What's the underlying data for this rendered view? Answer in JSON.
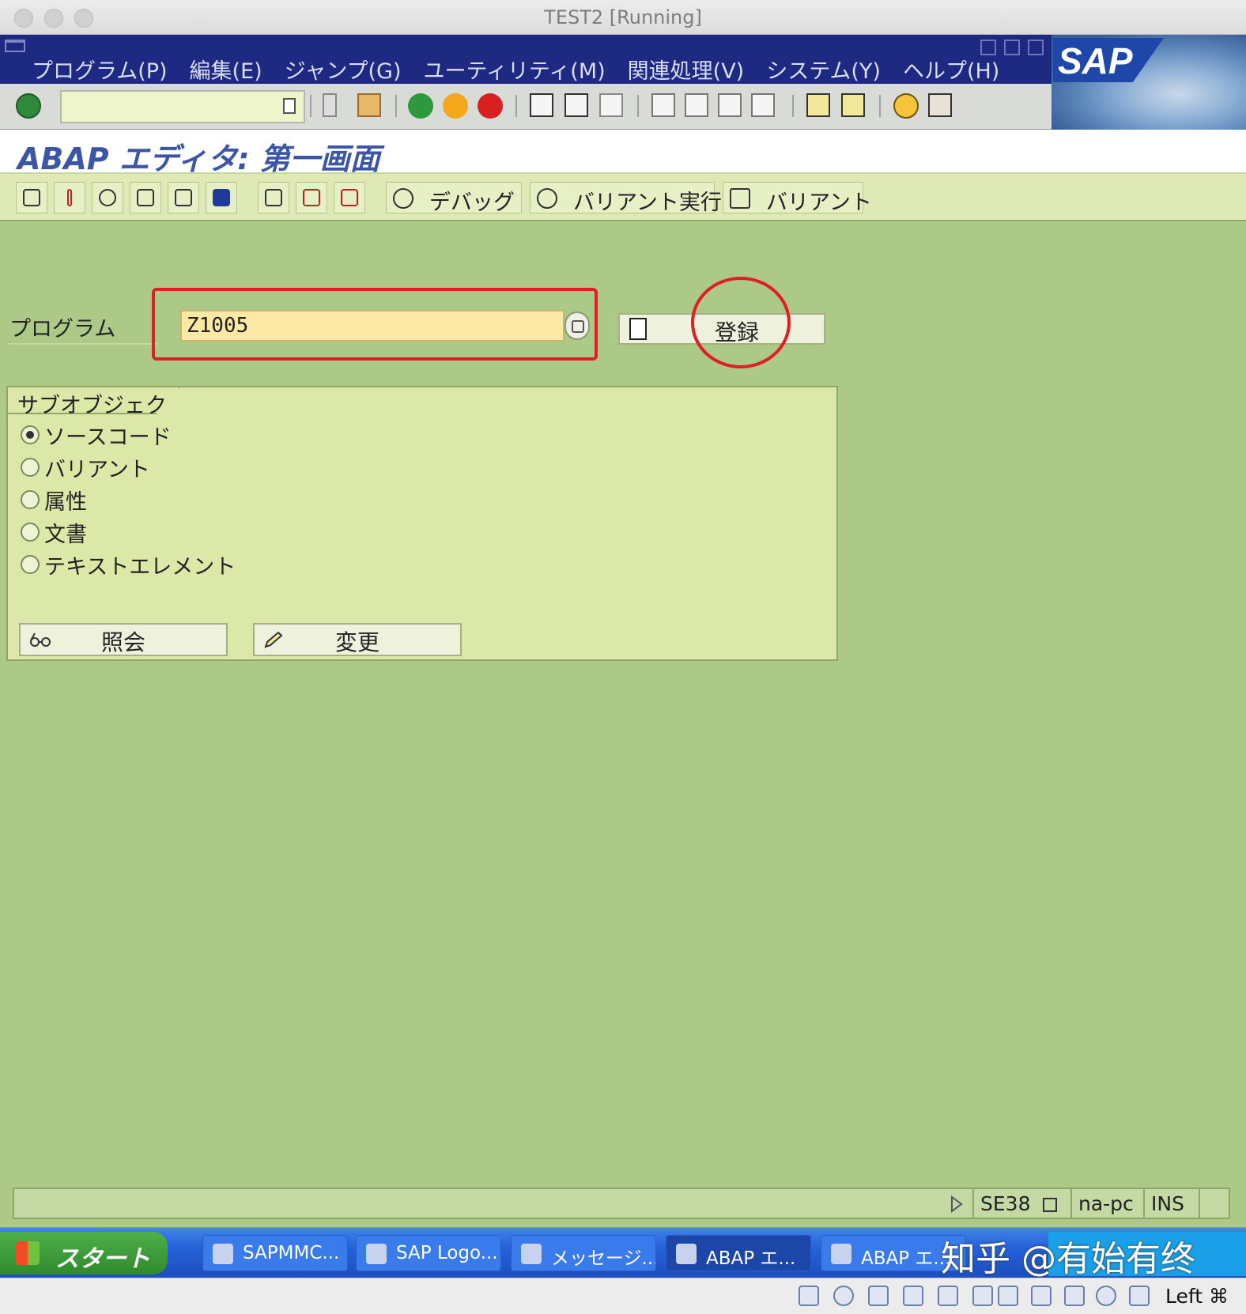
{
  "window": {
    "title": "TEST2 [Running]"
  },
  "menu": [
    "プログラム(P)",
    "編集(E)",
    "ジャンプ(G)",
    "ユーティリティ(M)",
    "関連処理(V)",
    "システム(Y)",
    "ヘルプ(H)"
  ],
  "brand": {
    "logo_text": "SAP"
  },
  "command_field": {
    "value": ""
  },
  "page": {
    "title": "ABAP エディタ: 第一画面"
  },
  "app_toolbar": {
    "debug_label": "デバッグ",
    "variant_run_label": "バリアント実行",
    "variant_label": "バリアント"
  },
  "form": {
    "program_label": "プログラム",
    "program_value": "Z1005",
    "create_label": "登録"
  },
  "subobjects": {
    "title": "サブオブジェクト",
    "options": [
      "ソースコード",
      "バリアント",
      "属性",
      "文書",
      "テキストエレメント"
    ],
    "selected_index": 0,
    "display_label": "照会",
    "change_label": "変更"
  },
  "status": {
    "transaction": "SE38",
    "server": "na-pc",
    "mode": "INS"
  },
  "taskbar": {
    "start_label": "スタート",
    "tasks": [
      "SAPMMC...",
      "SAP Logo...",
      "メッセージ...",
      "ABAP エ...",
      "ABAP エ..."
    ],
    "watermark": "知乎 @有始有终"
  },
  "host_bar": {
    "key_label": "Left ⌘"
  },
  "colors": {
    "menu_bg": "#1e2a82",
    "content_bg": "#acc987",
    "highlight": "#e01e25",
    "input_bg": "#fde9a6"
  }
}
